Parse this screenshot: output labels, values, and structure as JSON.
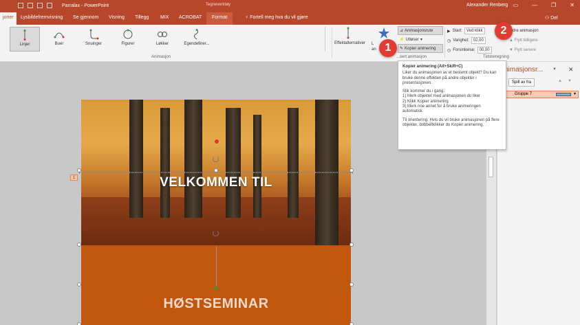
{
  "titlebar": {
    "title": "Parralax - PowerPoint",
    "context_group": "Tegneverktøy",
    "user": "Alexander Renberg",
    "window_buttons": [
      "▭",
      "—",
      "❐",
      "✕"
    ]
  },
  "tabs": {
    "items": [
      "joner",
      "Lysbildefremvisning",
      "Se gjennom",
      "Visning",
      "Tillegg",
      "MIX",
      "ACROBAT",
      "Format"
    ],
    "active": "joner",
    "tell_me": "Fortell meg hva du vil gjøre",
    "share": "Del"
  },
  "ribbon": {
    "animations": [
      {
        "label": "Linjer",
        "selected": true
      },
      {
        "label": "Buer",
        "selected": false
      },
      {
        "label": "Snuinger",
        "selected": false
      },
      {
        "label": "Figurer",
        "selected": false
      },
      {
        "label": "Løkker",
        "selected": false
      },
      {
        "label": "Egendefiner...",
        "selected": false
      }
    ],
    "group_animation": "Animasjon",
    "effect_options": "Effektalternativer",
    "add_animation_partial": "L",
    "add_animation_partial2": "an",
    "advanced": {
      "pane": "Animasjonsrute",
      "trigger": "Utløser",
      "painter": "Kopier animering",
      "group": "...sert animasjon"
    },
    "timing": {
      "start_label": "Start:",
      "start_value": "Ved klikk",
      "duration_label": "Varighet:",
      "duration_value": "02,00",
      "delay_label": "Forsinkelse:",
      "delay_value": "00,00",
      "group": "Tidsberegning"
    },
    "reorder": {
      "title": "...dre animasjon",
      "earlier": "Flytt tidligere",
      "later": "Flytt senere"
    }
  },
  "tooltip": {
    "title": "Kopier animering (Alt+Skift+C)",
    "p1": "Liker du animasjonen av et bestemt objekt? Du kan bruke denne effekten på andre objekter i presentasjonen.",
    "p2_head": "Slik kommer du i gang:",
    "p2_steps": [
      "1) Merk objektet med animasjonen du liker",
      "2) Klikk Kopier animering",
      "3) Merk noe annet for å bruke animeringen automatisk"
    ],
    "p3": "Til orientering: Hvis du vil bruke animasjonen på flere objekter, dobbeltklikker du Kopier animering."
  },
  "slide": {
    "title": "VELKOMMEN TIL",
    "subtitle": "HØSTSEMINAR",
    "anim_tag": "1",
    "band_color": "#c1560d"
  },
  "pane": {
    "title": "nimasjonsr...",
    "play": "Spill av fra",
    "item": "Gruppe 7",
    "item_dropdown": "▾"
  },
  "callouts": [
    "1",
    "2"
  ],
  "colors": {
    "accent": "#b7472a",
    "callout": "#e03c31"
  }
}
